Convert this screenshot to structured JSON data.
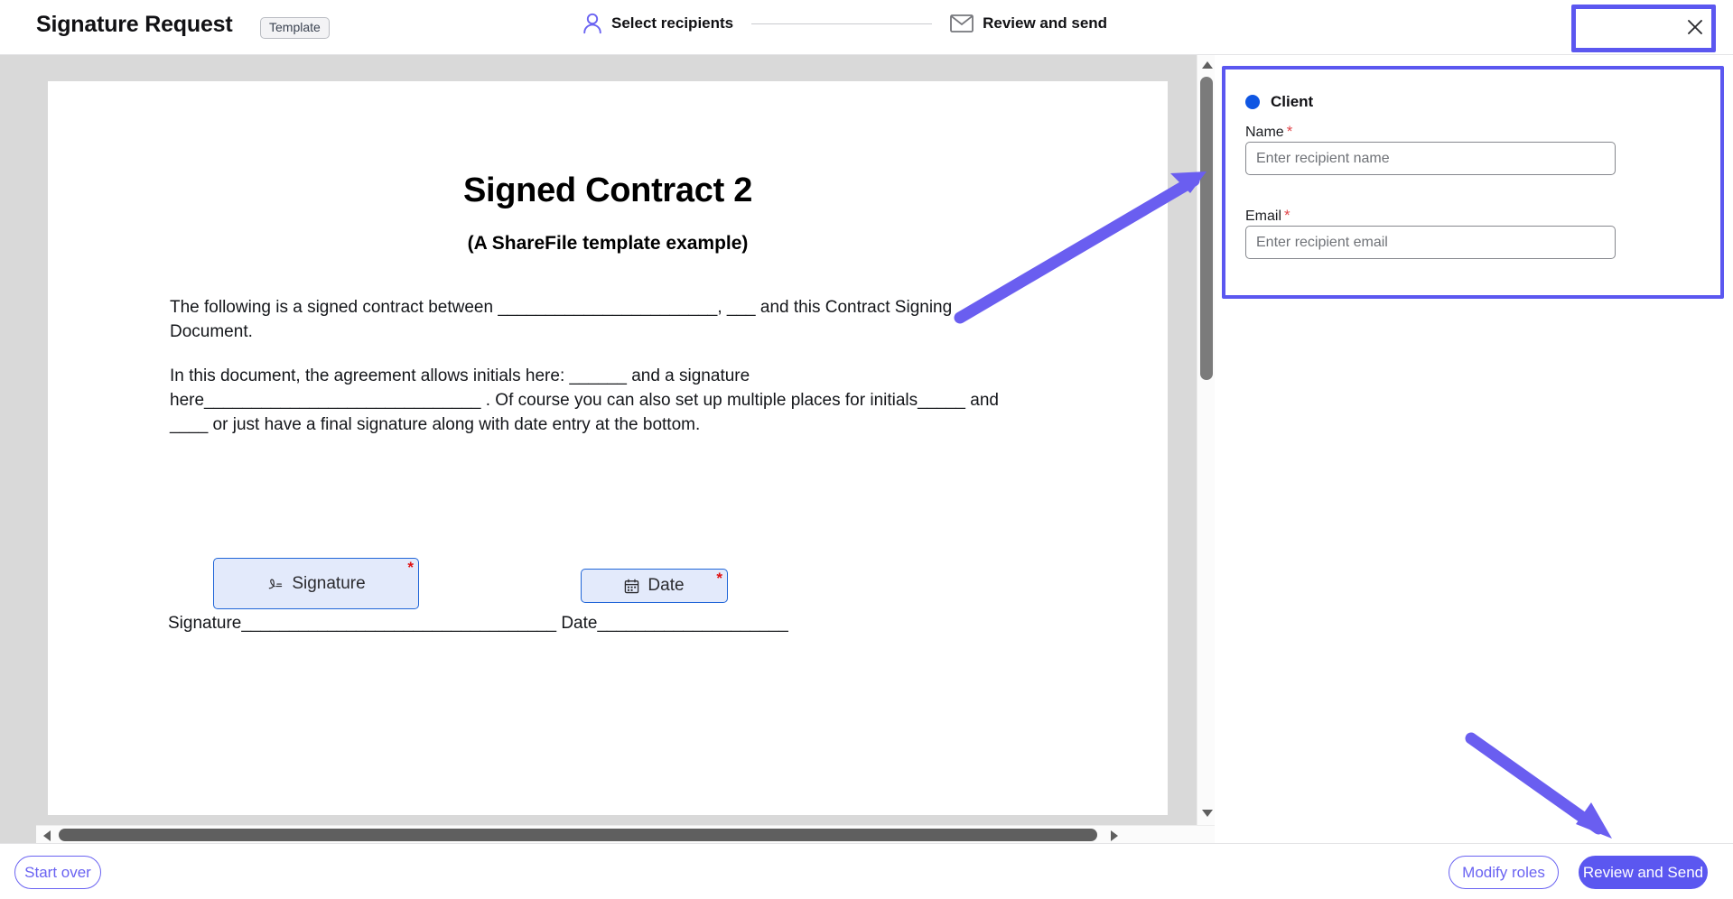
{
  "header": {
    "title": "Signature Request",
    "badge": "Template",
    "close_icon": "close-icon",
    "steps": [
      {
        "label": "Select recipients",
        "icon": "person-icon",
        "state": "active"
      },
      {
        "label": "Review and send",
        "icon": "mail-icon",
        "state": "inactive"
      }
    ]
  },
  "document": {
    "title": "Signed Contract 2",
    "subtitle": "(A ShareFile template example)",
    "paragraph1": "The following is a signed contract between _______________________, ___ and this Contract Signing Document.",
    "paragraph2": "In this document, the agreement allows initials here: ______ and a signature here_____________________________ . Of course you can also set up multiple places for initials_____ and ____ or just have a final signature along with date entry at the bottom.",
    "signature_line": "Signature_________________________________ Date____________________",
    "fields": [
      {
        "label": "Signature",
        "icon": "signature-icon",
        "required_marker": "*"
      },
      {
        "label": "Date",
        "icon": "calendar-icon",
        "required_marker": "*"
      }
    ]
  },
  "recipient_panel": {
    "role_name": "Client",
    "role_dot_color": "#0f56e3",
    "name_label": "Name",
    "name_required": "*",
    "name_value": "",
    "name_placeholder": "Enter recipient name",
    "email_label": "Email",
    "email_required": "*",
    "email_value": "",
    "email_placeholder": "Enter recipient email"
  },
  "footer": {
    "start_over": "Start over",
    "modify_roles": "Modify roles",
    "review_and_send": "Review and Send"
  },
  "annotations": {
    "accent_color": "#6a5ef0",
    "highlight_color": "#5b57f0",
    "arrow_to_recipient_panel": "arrow-icon",
    "arrow_to_review_button": "arrow-icon"
  }
}
